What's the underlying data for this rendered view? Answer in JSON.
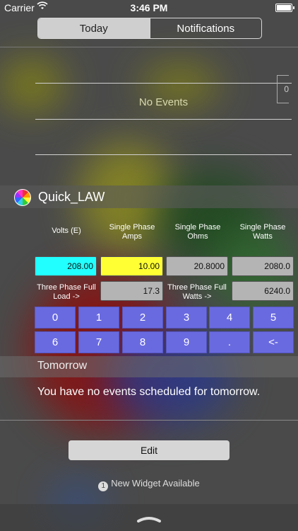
{
  "status": {
    "carrier": "Carrier",
    "time": "3:46 PM",
    "wifi_icon": "wifi-icon",
    "battery_level": 1.0
  },
  "tabs": [
    {
      "label": "Today",
      "active": true
    },
    {
      "label": "Notifications",
      "active": false
    }
  ],
  "today": {
    "no_events": "No Events",
    "box_value": "0"
  },
  "widget": {
    "title": "Quick_LAW",
    "columns": {
      "volts": "Volts (E)",
      "amps": "Single Phase Amps",
      "ohms": "Single Phase Ohms",
      "watts": "Single Phase Watts"
    },
    "values": {
      "volts": "208.00",
      "amps": "10.00",
      "ohms": "20.8000",
      "watts": "2080.0"
    },
    "three_phase": {
      "load_label": "Three Phase Full Load ->",
      "load_value": "17.3",
      "watts_label": "Three Phase Full Watts ->",
      "watts_value": "6240.0"
    },
    "keypad": [
      "0",
      "1",
      "2",
      "3",
      "4",
      "5",
      "6",
      "7",
      "8",
      "9",
      ".",
      "<-"
    ],
    "colors": {
      "volts": "#22ffff",
      "amps": "#ffff33",
      "readout": "#b4b4b4",
      "key": "#6a6ae0"
    }
  },
  "tomorrow": {
    "title": "Tomorrow",
    "message": "You have no events scheduled for tomorrow."
  },
  "footer": {
    "edit_label": "Edit",
    "new_widget_count": "1",
    "new_widget_text": "New Widget Available"
  }
}
